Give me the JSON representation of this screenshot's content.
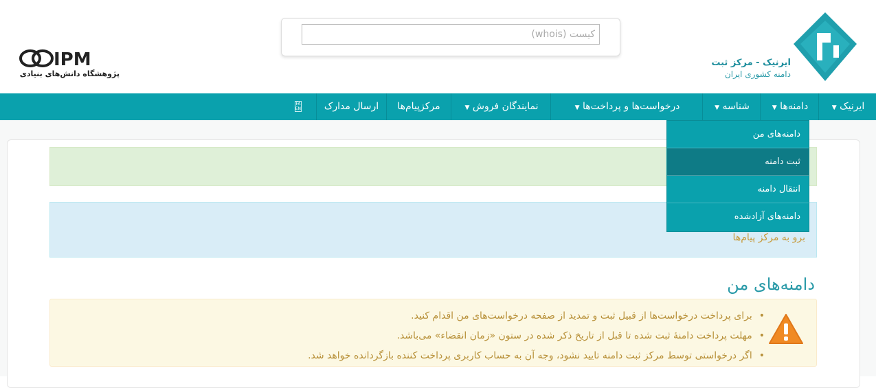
{
  "header": {
    "irnic_title": "ایرنیک - مرکز ثبت",
    "irnic_subtitle": "دامنه کشوری ایران",
    "search_placeholder": "کیست (whois)",
    "ipm_logo_text": "IPM",
    "ipm_caption": "پژوهشگاه دانش‌های بنیادی"
  },
  "nav": {
    "items": [
      {
        "label": "ایرنیک",
        "dropdown": true
      },
      {
        "label": "دامنه‌ها",
        "dropdown": true
      },
      {
        "label": "شناسه",
        "dropdown": true
      },
      {
        "label": "درخواست‌ها و پرداخت‌ها",
        "dropdown": true
      },
      {
        "label": "نمایندگان فروش",
        "dropdown": true
      },
      {
        "label": "مرکزپیام‌ها",
        "dropdown": false
      },
      {
        "label": "ارسال مدارک",
        "dropdown": false
      }
    ],
    "language_icon": "language-switch-icon"
  },
  "dropdown": {
    "items": [
      {
        "label": "دامنه‌های من",
        "active": false
      },
      {
        "label": "ثبت دامنه",
        "active": true
      },
      {
        "label": "انتقال دامنه",
        "active": false
      },
      {
        "label": "دامنه‌های آزادشده",
        "active": false
      }
    ]
  },
  "content": {
    "message_center_link": "برو به مرکز پیام‌ها",
    "section_title": "دامنه‌های من",
    "warning_icon": "warning-triangle-icon",
    "notes": [
      "برای پرداخت درخواست‌ها از قبیل ثبت و تمدید از صفحه درخواست‌های من اقدام کنید.",
      "مهلت پرداخت دامنهٔ ثبت شده تا قبل از تاریخ ذکر شده در ستون «زمان انقضاء» می‌باشد.",
      "اگر درخواستی توسط مرکز ثبت دامنه تایید نشود، وجه آن به حساب کاربری پرداخت کننده بازگردانده خواهد شد."
    ]
  },
  "colors": {
    "nav_bg": "#0aa1ad",
    "dropdown_active": "#0e7b86",
    "accent_teal": "#2a9aa8",
    "warning_text": "#b8913a",
    "warning_icon": "#f08a24"
  }
}
